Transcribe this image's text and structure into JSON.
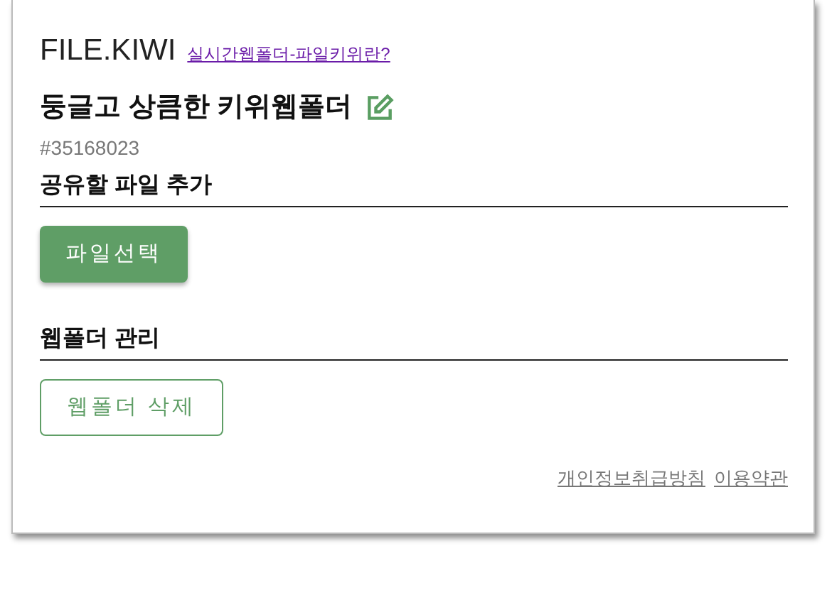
{
  "header": {
    "logo": "FILE.KIWI",
    "help_link": "실시간웹폴더-파일키위란?"
  },
  "folder": {
    "title": "둥글고 상큼한 키위웹폴더",
    "id": "#35168023"
  },
  "sections": [
    {
      "heading": "공유할 파일 추가",
      "button": {
        "label": "파일선택",
        "kind": "filled"
      }
    },
    {
      "heading": "웹폴더 관리",
      "button": {
        "label": "웹폴더 삭제",
        "kind": "outline"
      }
    }
  ],
  "footer_links": [
    "개인정보취급방침",
    "이용약관"
  ]
}
